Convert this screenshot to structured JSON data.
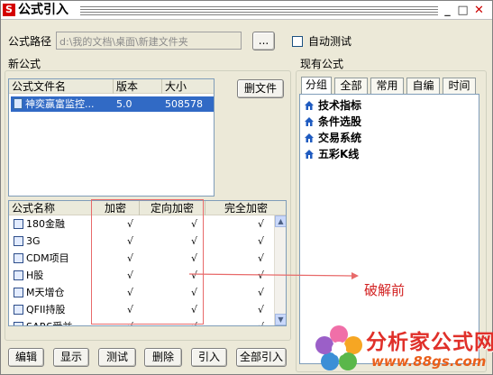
{
  "window": {
    "title": "公式引入"
  },
  "path": {
    "label": "公式路径",
    "value": "d:\\我的文档\\桌面\\新建文件夹",
    "browse_label": "...",
    "auto_test_label": "自动测试",
    "auto_test_checked": false
  },
  "new_formula": {
    "group_label": "新公式",
    "delete_button": "删文件",
    "files_columns": [
      "公式文件名",
      "版本",
      "大小"
    ],
    "files": [
      {
        "name": "神奕赢富监控...",
        "version": "5.0",
        "size": "508578",
        "selected": true
      }
    ],
    "formula_columns": [
      "公式名称",
      "加密",
      "定向加密",
      "完全加密"
    ],
    "formulas": [
      {
        "name": "180金融",
        "enc": "√",
        "dir_enc": "√",
        "full_enc": "√"
      },
      {
        "name": "3G",
        "enc": "√",
        "dir_enc": "√",
        "full_enc": "√"
      },
      {
        "name": "CDM项目",
        "enc": "√",
        "dir_enc": "√",
        "full_enc": "√"
      },
      {
        "name": "H股",
        "enc": "√",
        "dir_enc": "√",
        "full_enc": "√"
      },
      {
        "name": "M天增仓",
        "enc": "√",
        "dir_enc": "√",
        "full_enc": "√"
      },
      {
        "name": "QFII持股",
        "enc": "√",
        "dir_enc": "√",
        "full_enc": "√"
      },
      {
        "name": "SARS受益",
        "enc": "√",
        "dir_enc": "√",
        "full_enc": "√"
      }
    ]
  },
  "actions": {
    "edit": "编辑",
    "show": "显示",
    "test": "测试",
    "delete": "删除",
    "import": "引入",
    "import_all": "全部引入"
  },
  "existing": {
    "group_label": "现有公式",
    "tabs": [
      "分组",
      "全部",
      "常用",
      "自编",
      "时间"
    ],
    "active_tab": 0,
    "tree_items": [
      "技术指标",
      "条件选股",
      "交易系统",
      "五彩K线"
    ]
  },
  "annotation": {
    "text": "破解前",
    "color": "#d21f1f"
  },
  "watermark": {
    "title": "分析家公式网",
    "url": "www.88gs.com"
  },
  "colors": {
    "selection": "#316ac5",
    "annotation_box": "#e86a6a"
  }
}
